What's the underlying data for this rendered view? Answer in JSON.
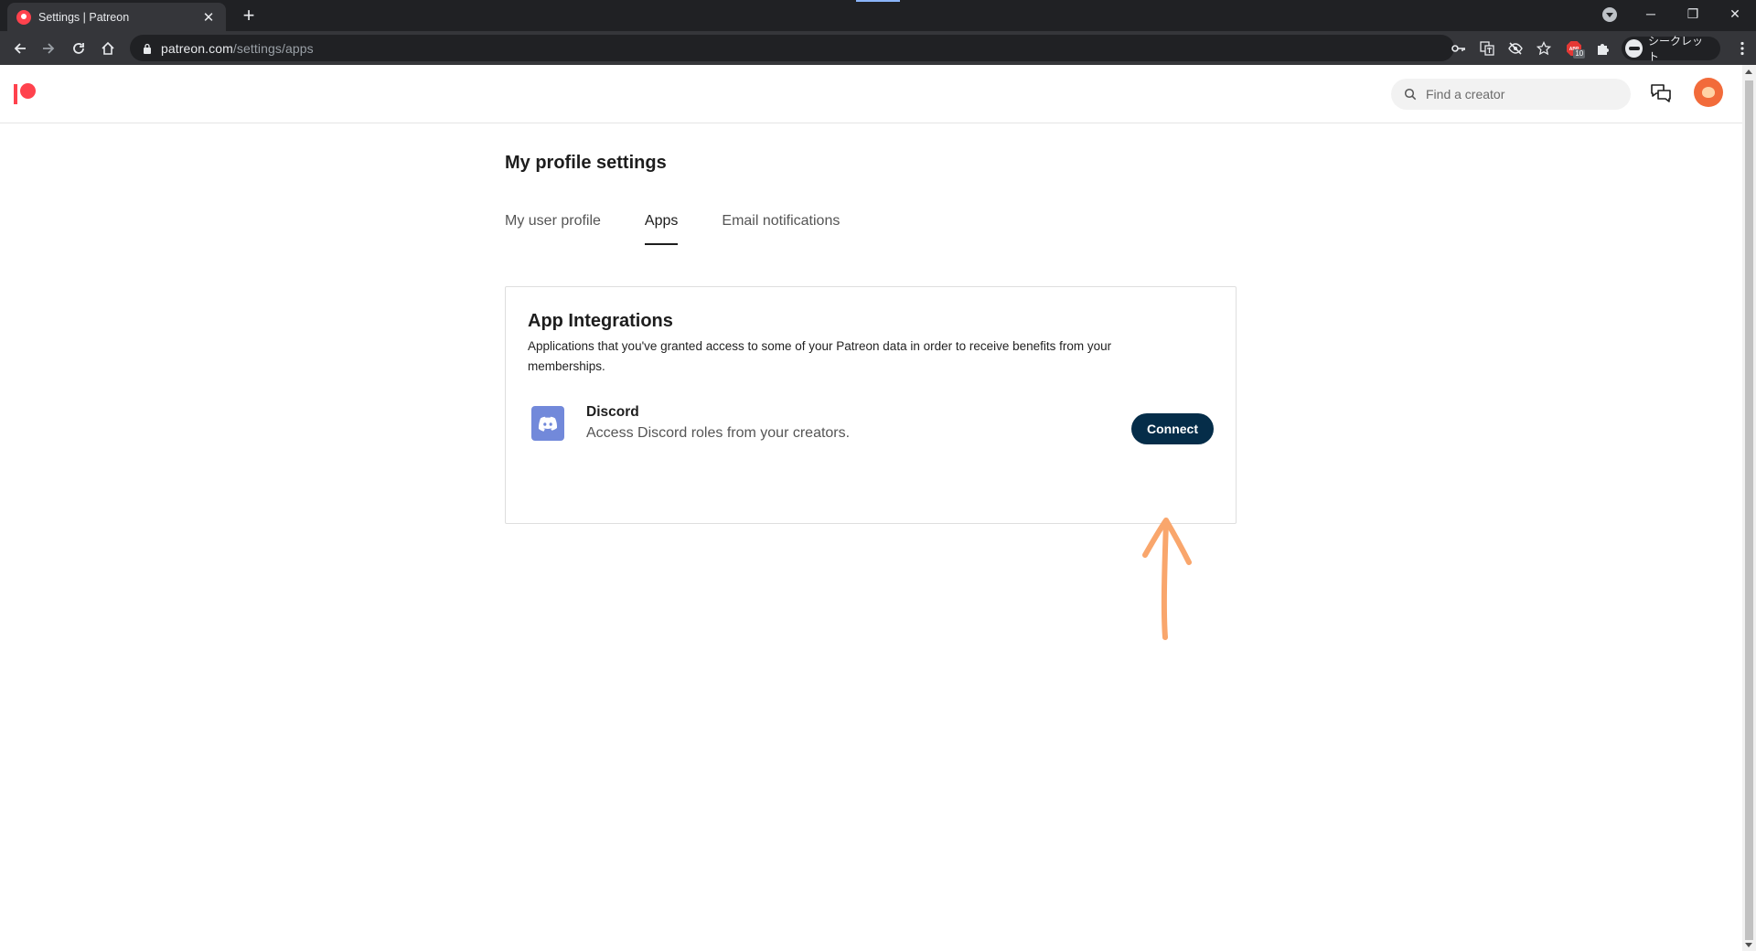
{
  "browser": {
    "tab_title": "Settings | Patreon",
    "tab_close": "✕",
    "new_tab": "+",
    "url_host": "patreon.com",
    "url_path": "/settings/apps",
    "extension_badge": "10",
    "incognito_label": "シークレット",
    "window_buttons": {
      "minimize": "─",
      "restore": "❐",
      "close": "✕"
    }
  },
  "header": {
    "search_placeholder": "Find a creator"
  },
  "settings": {
    "title": "My profile settings",
    "tabs": [
      {
        "label": "My user profile",
        "active": false
      },
      {
        "label": "Apps",
        "active": true
      },
      {
        "label": "Email notifications",
        "active": false
      }
    ]
  },
  "integrations": {
    "title": "App Integrations",
    "description": "Applications that you've granted access to some of your Patreon data in order to receive benefits from your memberships.",
    "apps": [
      {
        "name": "Discord",
        "description": "Access Discord roles from your creators.",
        "button_label": "Connect",
        "icon": "discord-icon"
      }
    ]
  },
  "colors": {
    "brand": "#ff424d",
    "connect_button": "#052d49",
    "discord": "#7289da",
    "annotation_arrow": "#f9a66c"
  }
}
